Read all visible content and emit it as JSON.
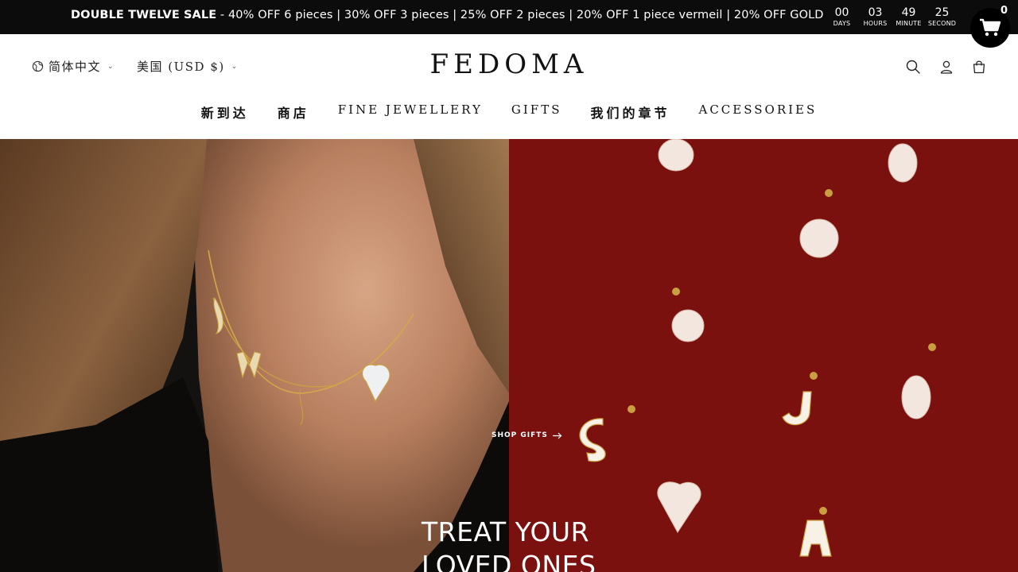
{
  "announcement": {
    "sale_title": "DOUBLE TWELVE SALE",
    "sale_details": " - 40% OFF 6 pieces | 30% OFF 3 pieces | 25% OFF 2 pieces | 20% OFF 1 piece vermeil | 20% OFF GOLD",
    "countdown": [
      {
        "value": "00",
        "label": "DAYS"
      },
      {
        "value": "03",
        "label": "HOURS"
      },
      {
        "value": "49",
        "label": "MINUTE"
      },
      {
        "value": "25",
        "label": "SECOND"
      }
    ]
  },
  "cart": {
    "count": "0"
  },
  "header": {
    "language": "简体中文",
    "currency": "美国 (USD $)",
    "logo": "FEDOMA",
    "icons": [
      "search-icon",
      "account-icon",
      "bag-icon"
    ]
  },
  "nav": {
    "items": [
      {
        "label": "新到达"
      },
      {
        "label": "商店"
      },
      {
        "label": "FINE JEWELLERY"
      },
      {
        "label": "GIFTS"
      },
      {
        "label": "我们的章节"
      },
      {
        "label": "ACCESSORIES"
      }
    ]
  },
  "hero": {
    "cta": "SHOP GIFTS",
    "title_line1": "TREAT YOUR",
    "title_line2": "LOVED ONES"
  },
  "colors": {
    "announcement_bg": "#0c0c0c",
    "hero_right_bg": "#7a110f"
  }
}
